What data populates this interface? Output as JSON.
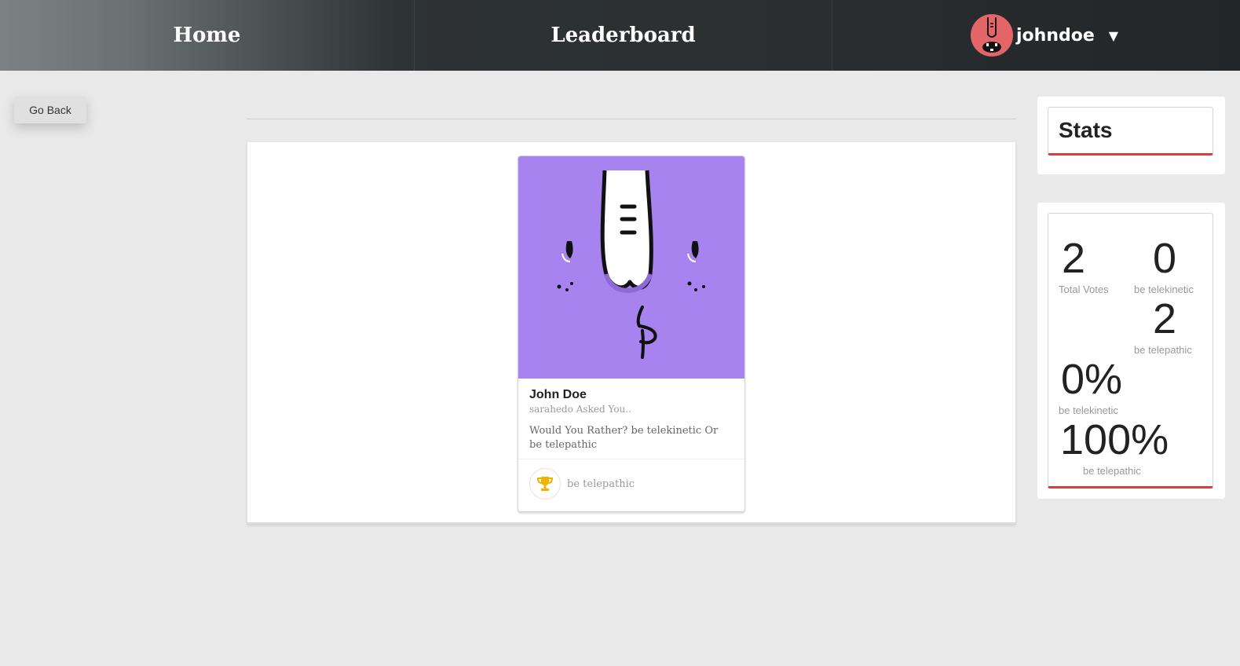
{
  "nav": {
    "home": "Home",
    "leaderboard": "Leaderboard",
    "username": "johndoe",
    "caret": "▼"
  },
  "go_back": "Go Back",
  "question_card": {
    "author_name": "John Doe",
    "asked_text": "sarahedo Asked You..",
    "question_text": "Would You Rather? be telekinetic Or be telepathic",
    "answer": "be telepathic",
    "image_bg_color": "#a683ee"
  },
  "stats": {
    "title": "Stats",
    "total_votes": "2",
    "total_votes_label": "Total Votes",
    "option_one_votes": "0",
    "option_one_label": "be telekinetic",
    "option_two_votes": "2",
    "option_two_label": "be telepathic",
    "option_one_percent": "0%",
    "option_one_percent_label": "be telekinetic",
    "option_two_percent": "100%",
    "option_two_percent_label": "be telepathic"
  },
  "colors": {
    "accent_red": "#db3b3b",
    "avatar_bg": "#e36567",
    "trophy": "#f0b400"
  }
}
